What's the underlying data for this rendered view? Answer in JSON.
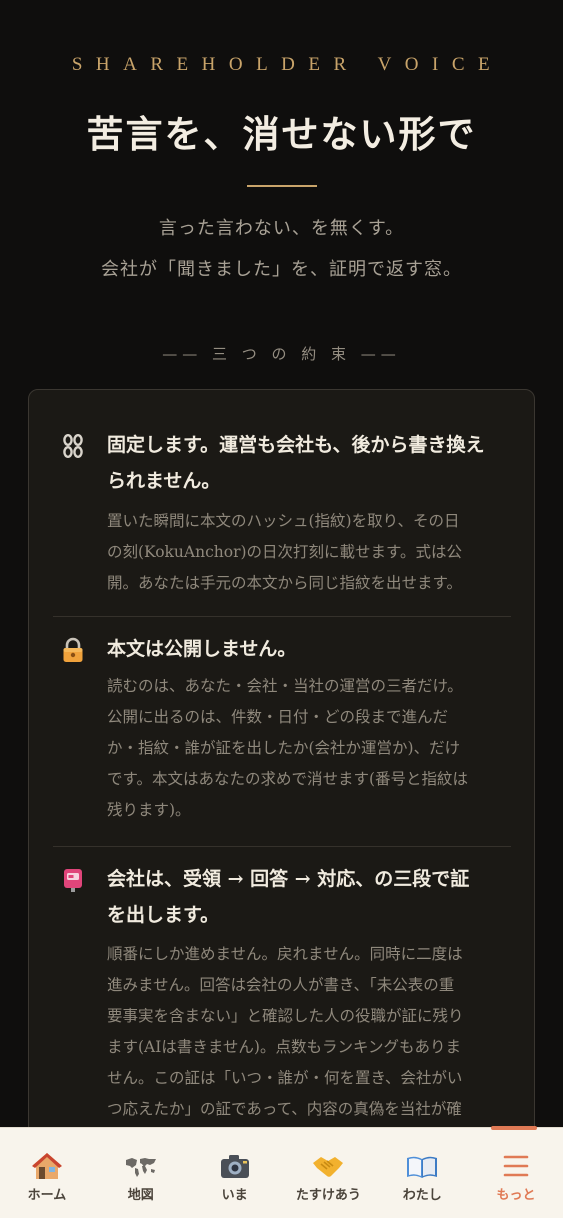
{
  "hero": {
    "eyebrow": "SHAREHOLDER VOICE",
    "title": "苦言を、消せない形で",
    "subtitle_line1": "言った言わない、を無くす。",
    "subtitle_line2": "会社が「聞きました」を、証明で返す窓。"
  },
  "section": {
    "label": "—— 三 つ の 約 束 ——"
  },
  "promises": [
    {
      "icon": "chain-link-icon",
      "heading_lines": [
        "固定します。運営も会社も、後から書き換え",
        "られません。"
      ],
      "body_lines": [
        "置いた瞬間に本文のハッシュ(指紋)を取り、その日",
        "の刻(KokuAnchor)の日次打刻に載せます。式は公",
        "開。あなたは手元の本文から同じ指紋を出せます。"
      ]
    },
    {
      "icon": "lock-icon",
      "heading_lines": [
        "本文は公開しません。"
      ],
      "body_lines": [
        "読むのは、あなた・会社・当社の運営の三者だけ。",
        "公開に出るのは、件数・日付・どの段まで進んだ",
        "か・指紋・誰が証を出したか(会社か運営か)、だけ",
        "です。本文はあなたの求めで消せます(番号と指紋は",
        "残ります)。"
      ]
    },
    {
      "icon": "postbox-icon",
      "heading_lines": [
        "会社は、受領 → 回答 → 対応、の三段で証",
        "を出します。"
      ],
      "body_lines": [
        "順番にしか進めません。戻れません。同時に二度は",
        "進みません。回答は会社の人が書き、「未公表の重",
        "要事実を含まない」と確認した人の役職が証に残り",
        "ます(AIは書きません)。点数もランキングもありま",
        "せん。この証は「いつ・誰が・何を置き、会社がい",
        "つ応えたか」の証であって、内容の真偽を当社が確"
      ]
    }
  ],
  "tabbar": {
    "active": 5,
    "tabs": [
      {
        "label": "ホーム",
        "icon": "house-icon"
      },
      {
        "label": "地図",
        "icon": "world-map-icon"
      },
      {
        "label": "いま",
        "icon": "camera-icon"
      },
      {
        "label": "たすけあう",
        "icon": "handshake-icon"
      },
      {
        "label": "わたし",
        "icon": "open-book-icon"
      },
      {
        "label": "もっと",
        "icon": "menu-icon"
      }
    ]
  },
  "colors": {
    "background": "#0f0e0d",
    "gold": "#c9a46a",
    "accent": "#e07a55"
  }
}
